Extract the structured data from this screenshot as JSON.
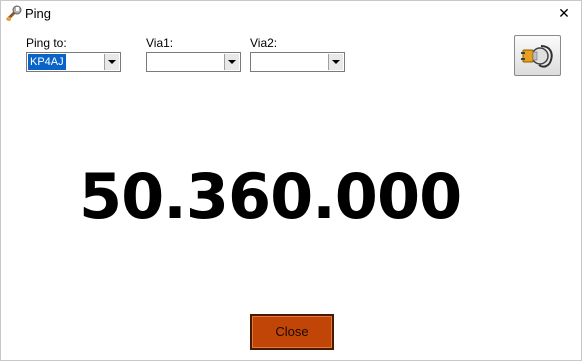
{
  "window": {
    "title": "Ping",
    "title_icon": "wrench-icon",
    "close_glyph": "✕"
  },
  "form": {
    "ping_to": {
      "label": "Ping to:",
      "value": "KP4AJ"
    },
    "via1": {
      "label": "Via1:",
      "value": ""
    },
    "via2": {
      "label": "Via2:",
      "value": ""
    }
  },
  "plug_button": {
    "icon": "plug-icon"
  },
  "frequency": "50.360.000",
  "close_button": {
    "label": "Close",
    "color": "#c24508"
  }
}
